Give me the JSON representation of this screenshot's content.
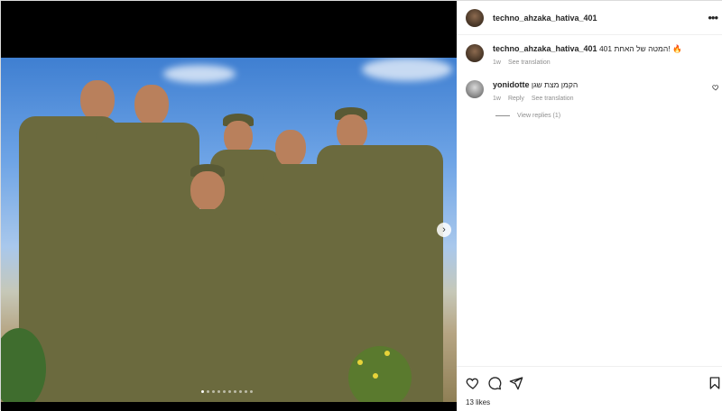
{
  "post": {
    "username": "techno_ahzaka_hativa_401",
    "caption_username": "techno_ahzaka_hativa_401",
    "caption_text": "401 המטה של האחת! 🔥",
    "caption_age": "1w",
    "caption_translate": "See translation",
    "likes": "13 likes",
    "slide_count": 10,
    "active_slide": 0
  },
  "comments": [
    {
      "username": "yonidotte",
      "text": "הקמן מצת שגן",
      "age": "1w",
      "reply_label": "Reply",
      "translate_label": "See translation",
      "view_replies": "View replies (1)"
    }
  ],
  "icons": {
    "more": "more-horizontal-icon",
    "like": "heart-icon",
    "comment": "comment-icon",
    "share": "send-icon",
    "save": "bookmark-icon",
    "next": "chevron-right-icon"
  }
}
